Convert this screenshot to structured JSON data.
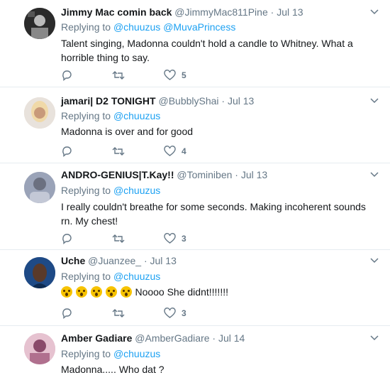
{
  "tweets": [
    {
      "name": "Jimmy Mac comin back",
      "handle": "@JimmyMac811Pine",
      "sep": "·",
      "time": "Jul 13",
      "replying_prefix": "Replying to",
      "mentions": [
        "@chuuzus",
        "@MuvaPrincess"
      ],
      "text": "Talent singing, Madonna couldn't hold a candle to Whitney. What a horrible thing to say.",
      "likes": "5"
    },
    {
      "name": "jamari| D2 TONIGHT",
      "handle": "@BubblyShai",
      "sep": "·",
      "time": "Jul 13",
      "replying_prefix": "Replying to",
      "mentions": [
        "@chuuzus"
      ],
      "text": "Madonna is over and for good",
      "likes": "4"
    },
    {
      "name": "ANDRO-GENIUS|T.Kay!!",
      "handle": "@Tominiben",
      "sep": "·",
      "time": "Jul 13",
      "replying_prefix": "Replying to",
      "mentions": [
        "@chuuzus"
      ],
      "text": "I really couldn't breathe for some seconds. Making incoherent sounds rn. My chest!",
      "likes": "3"
    },
    {
      "name": "Uche",
      "handle": "@Juanzee_",
      "sep": "·",
      "time": "Jul 13",
      "replying_prefix": "Replying to",
      "mentions": [
        "@chuuzus"
      ],
      "text": "Noooo She didnt!!!!!!!",
      "likes": "3"
    },
    {
      "name": "Amber Gadiare",
      "handle": "@AmberGadiare",
      "sep": "·",
      "time": "Jul 14",
      "replying_prefix": "Replying to",
      "mentions": [
        "@chuuzus"
      ],
      "text": "Madonna..... Who dat ?",
      "likes": ""
    }
  ],
  "colors": {
    "link": "#1da1f2",
    "muted": "#657786",
    "border": "#e6ecf0"
  }
}
